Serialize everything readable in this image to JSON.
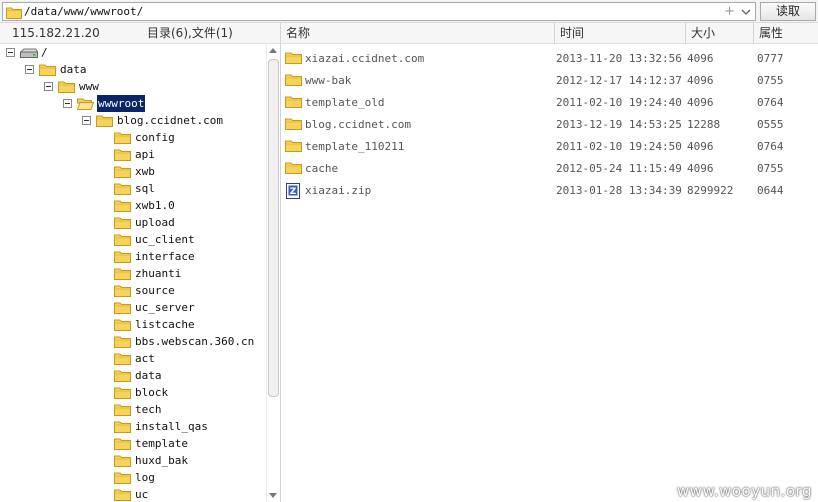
{
  "path_bar": {
    "path": "/data/www/wwwroot/",
    "plus_glyph": "+",
    "read_button_label": "读取"
  },
  "left_header": {
    "ip": "115.182.21.20",
    "counts": "目录(6),文件(1)"
  },
  "columns": {
    "name": "名称",
    "time": "时间",
    "size": "大小",
    "attr": "属性"
  },
  "tree": [
    {
      "label": "/",
      "icon": "drive-icon",
      "expanded": true
    },
    {
      "label": "data",
      "icon": "folder-icon",
      "expanded": true
    },
    {
      "label": "www",
      "icon": "folder-icon",
      "expanded": true
    },
    {
      "label": "wwwroot",
      "icon": "folder-open-icon",
      "expanded": true,
      "selected": true
    },
    {
      "label": "blog.ccidnet.com",
      "icon": "folder-icon",
      "expanded": true
    },
    {
      "label": "config",
      "icon": "folder-icon"
    },
    {
      "label": "api",
      "icon": "folder-icon"
    },
    {
      "label": "xwb",
      "icon": "folder-icon"
    },
    {
      "label": "sql",
      "icon": "folder-icon"
    },
    {
      "label": "xwb1.0",
      "icon": "folder-icon"
    },
    {
      "label": "upload",
      "icon": "folder-icon"
    },
    {
      "label": "uc_client",
      "icon": "folder-icon"
    },
    {
      "label": "interface",
      "icon": "folder-icon"
    },
    {
      "label": "zhuanti",
      "icon": "folder-icon"
    },
    {
      "label": "source",
      "icon": "folder-icon"
    },
    {
      "label": "uc_server",
      "icon": "folder-icon"
    },
    {
      "label": "listcache",
      "icon": "folder-icon"
    },
    {
      "label": "bbs.webscan.360.cn",
      "icon": "folder-icon"
    },
    {
      "label": "act",
      "icon": "folder-icon"
    },
    {
      "label": "data",
      "icon": "folder-icon"
    },
    {
      "label": "block",
      "icon": "folder-icon"
    },
    {
      "label": "tech",
      "icon": "folder-icon"
    },
    {
      "label": "install_qas",
      "icon": "folder-icon"
    },
    {
      "label": "template",
      "icon": "folder-icon"
    },
    {
      "label": "huxd_bak",
      "icon": "folder-icon"
    },
    {
      "label": "log",
      "icon": "folder-icon"
    },
    {
      "label": "uc",
      "icon": "folder-icon"
    }
  ],
  "files": [
    {
      "name": "xiazai.ccidnet.com",
      "time": "2013-11-20 13:32:56",
      "size": "4096",
      "attr": "0777",
      "icon": "folder-icon"
    },
    {
      "name": "www-bak",
      "time": "2012-12-17 14:12:37",
      "size": "4096",
      "attr": "0755",
      "icon": "folder-icon"
    },
    {
      "name": "template_old",
      "time": "2011-02-10 19:24:40",
      "size": "4096",
      "attr": "0764",
      "icon": "folder-icon"
    },
    {
      "name": "blog.ccidnet.com",
      "time": "2013-12-19 14:53:25",
      "size": "12288",
      "attr": "0555",
      "icon": "folder-icon"
    },
    {
      "name": "template_110211",
      "time": "2011-02-10 19:24:50",
      "size": "4096",
      "attr": "0764",
      "icon": "folder-icon"
    },
    {
      "name": "cache",
      "time": "2012-05-24 11:15:49",
      "size": "4096",
      "attr": "0755",
      "icon": "folder-icon"
    },
    {
      "name": "xiazai.zip",
      "time": "2013-01-28 13:34:39",
      "size": "8299922",
      "attr": "0644",
      "icon": "zip-file-icon"
    }
  ],
  "colors": {
    "folder_fill": "#f6d35a",
    "folder_stroke": "#c99a1b",
    "selection": "#0a246a"
  },
  "watermark": "www.wooyun.org"
}
